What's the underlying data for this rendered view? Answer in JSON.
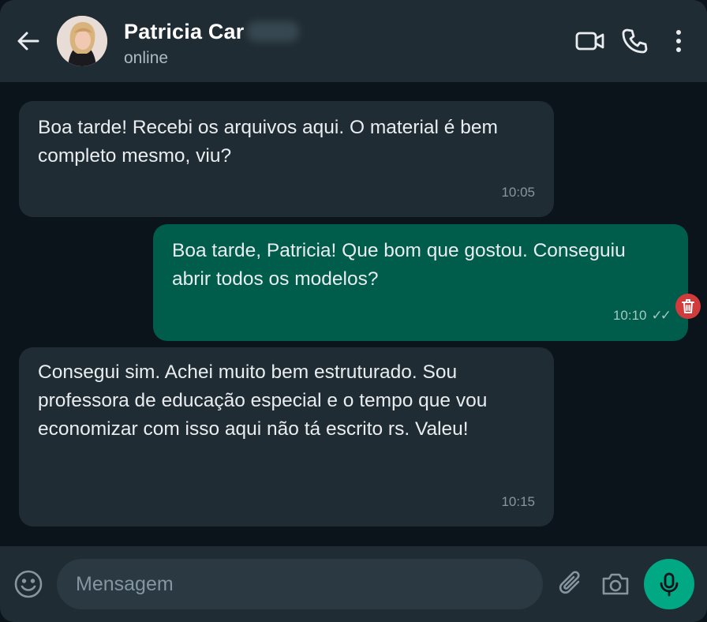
{
  "header": {
    "contact_name": "Patricia Car",
    "status": "online",
    "icons": {
      "back": "arrow-left-icon",
      "avatar": "contact-avatar",
      "video": "video-camera-icon",
      "phone": "phone-icon",
      "menu": "more-vertical-icon"
    }
  },
  "messages": [
    {
      "direction": "incoming",
      "text": "Boa tarde! Recebi os arquivos aqui. O material é bem completo mesmo, viu?",
      "time": "10:05"
    },
    {
      "direction": "outgoing",
      "text": "Boa tarde, Patricia! Que bom que gostou. Conseguiu abrir todos os modelos?",
      "time": "10:10",
      "ticks": "✓✓",
      "action_icon": "trash-icon"
    },
    {
      "direction": "incoming",
      "text": "Consegui sim. Achei muito bem estruturado. Sou professora de educação especial e o tempo que vou economizar com isso aqui não tá escrito rs. Valeu!",
      "time": "10:15"
    }
  ],
  "composer": {
    "placeholder": "Mensagem",
    "value": "",
    "icons": {
      "emoji": "emoji-icon",
      "attach": "paperclip-icon",
      "camera": "camera-icon",
      "mic": "microphone-icon"
    }
  },
  "colors": {
    "background": "#0b141a",
    "header": "#202c33",
    "incoming_bubble": "#202c33",
    "outgoing_bubble": "#005c4b",
    "accent": "#00a884",
    "delete": "#d23b3b"
  }
}
